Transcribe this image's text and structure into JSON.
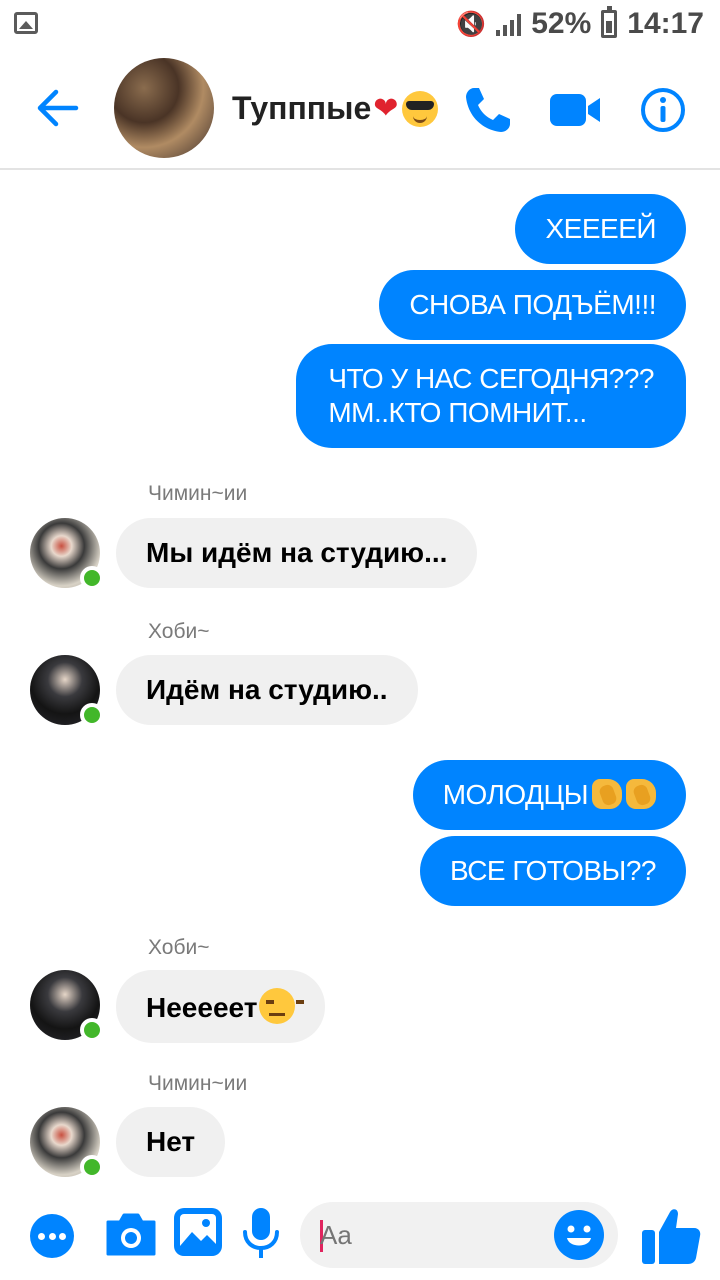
{
  "status_bar": {
    "battery_percent": "52%",
    "time": "14:17"
  },
  "header": {
    "chat_title": "Тупппые",
    "title_emojis": [
      "heart-emoji",
      "sunglasses-emoji"
    ]
  },
  "messages": {
    "out_1": "ХЕЕЕЕЙ",
    "out_2": "СНОВА ПОДЪЁМ!!!",
    "out_3_line1": "ЧТО У НАС СЕГОДНЯ???",
    "out_3_line2": "ММ..КТО ПОМНИТ...",
    "in_1_sender": "Чимин~ии",
    "in_1_text": "Мы идём на студию...",
    "in_2_sender": "Хоби~",
    "in_2_text": "Идём на студию..",
    "out_4": "МОЛОДЦЫ",
    "out_5": "ВСЕ ГОТОВЫ??",
    "in_3_sender": "Хоби~",
    "in_3_text": "Неееeет",
    "in_4_sender": "Чимин~ии",
    "in_4_text": "Нет"
  },
  "composer": {
    "placeholder": "Aa"
  },
  "colors": {
    "accent": "#0084ff",
    "incoming_bubble": "#f0f0f0",
    "online": "#42b72a"
  }
}
